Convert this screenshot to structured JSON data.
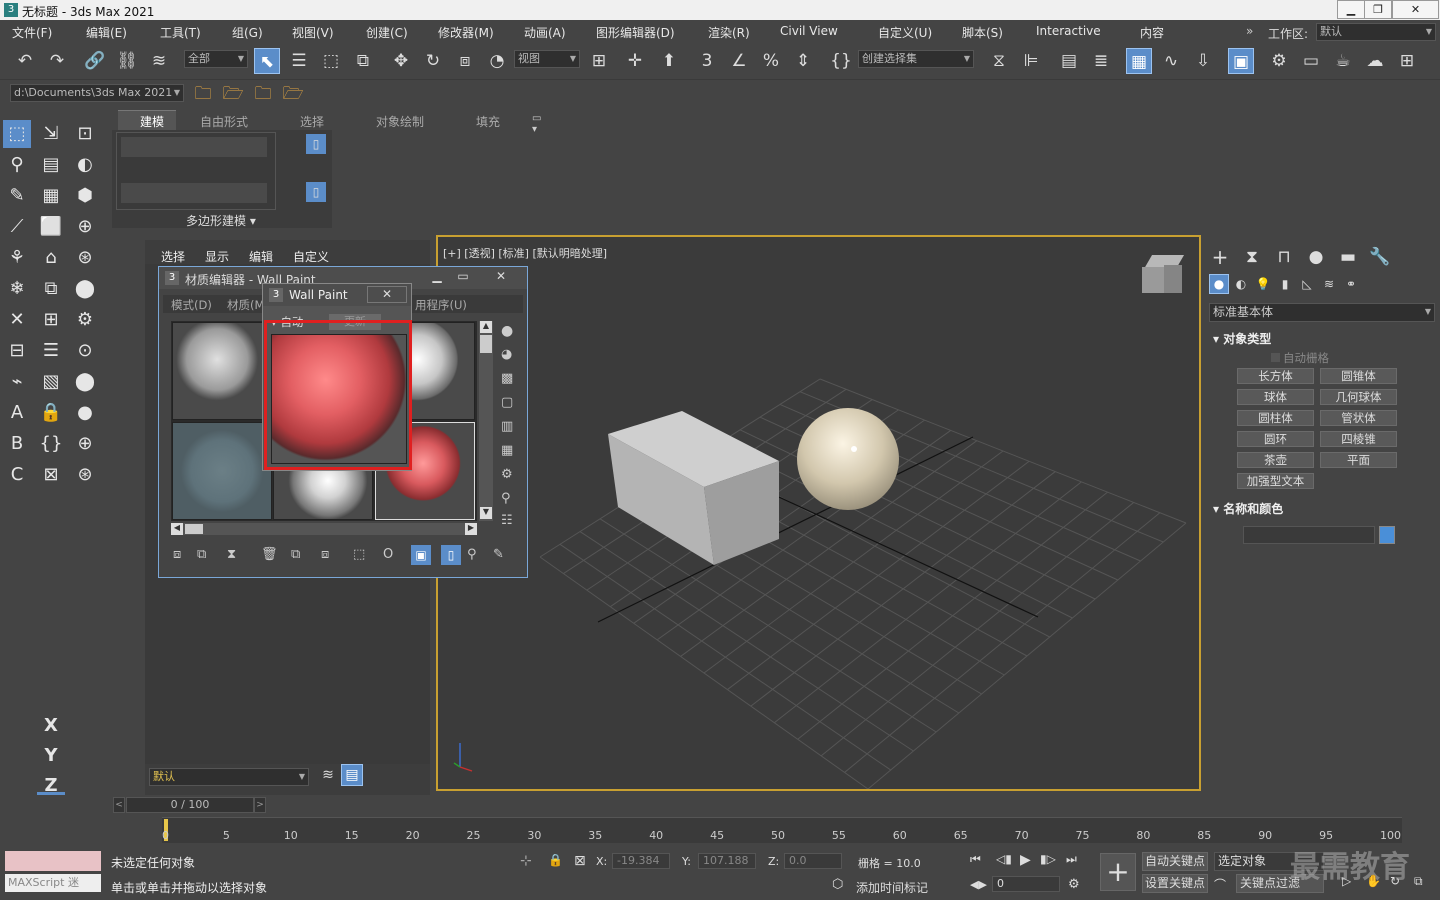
{
  "window": {
    "title": "无标题 - 3ds Max 2021"
  },
  "menu": [
    "文件(F)",
    "编辑(E)",
    "工具(T)",
    "组(G)",
    "视图(V)",
    "创建(C)",
    "修改器(M)",
    "动画(A)",
    "图形编辑器(D)",
    "渲染(R)",
    "Civil View",
    "自定义(U)",
    "脚本(S)",
    "Interactive",
    "内容"
  ],
  "workspace": {
    "label": "工作区:",
    "value": "默认"
  },
  "toolbar": {
    "filter_value": "全部",
    "refcoord_value": "视图",
    "selset_value": "创建选择集",
    "path_value": "d:\\Documents\\3ds Max 2021",
    "icons": [
      "undo-icon",
      "redo-icon",
      "link-icon",
      "unlink-icon",
      "bind-space-warp-icon",
      "select-icon",
      "select-by-name-icon",
      "rect-select-icon",
      "window-crossing-icon",
      "move-icon",
      "rotate-icon",
      "scale-icon",
      "select-manipulate-icon"
    ]
  },
  "ribbon": {
    "tabs": [
      "建模",
      "自由形式",
      "选择",
      "对象绘制",
      "填充"
    ],
    "active_tab": "建模",
    "group_label": "多边形建模"
  },
  "scene_explorer": {
    "tabs": [
      "选择",
      "显示",
      "编辑",
      "自定义"
    ],
    "layer_value": "默认",
    "frame_counter": "0 / 100"
  },
  "viewport": {
    "label": "[+] [透视] [标准] [默认明暗处理]"
  },
  "command_panel": {
    "category": "标准基本体",
    "object_type_header": "对象类型",
    "autogrid": "自动栅格",
    "buttons": [
      "长方体",
      "圆锥体",
      "球体",
      "几何球体",
      "圆柱体",
      "管状体",
      "圆环",
      "四棱锥",
      "茶壶",
      "平面",
      "加强型文本"
    ],
    "name_color_header": "名称和颜色",
    "swatch_color": "#4a8fd8"
  },
  "material_editor": {
    "title": "材质编辑器 - Wall Paint",
    "menus": [
      "模式(D)",
      "材质(M",
      "用程序(U)"
    ],
    "popup_title": "Wall Paint",
    "popup_auto": "自动",
    "popup_update": "更新"
  },
  "timeline": {
    "ticks": [
      "0",
      "5",
      "10",
      "15",
      "20",
      "25",
      "30",
      "35",
      "40",
      "45",
      "50",
      "55",
      "60",
      "65",
      "70",
      "75",
      "80",
      "85",
      "90",
      "95",
      "100"
    ]
  },
  "status": {
    "maxscript": "MAXScript 迷",
    "line1": "未选定任何对象",
    "line2": "单击或单击并拖动以选择对象",
    "x_label": "X:",
    "x_value": "-19.384",
    "y_label": "Y:",
    "y_value": "107.188",
    "z_label": "Z:",
    "z_value": "0.0",
    "grid": "栅格 = 10.0",
    "add_time_tag": "添加时间标记",
    "auto_key": "自动关键点",
    "set_key": "设置关键点",
    "selected_object": "选定对象",
    "key_filters": "关键点过滤器...",
    "frame_value": "0",
    "watermark": "最需教育"
  },
  "colors": {
    "accent": "#5b8dc9",
    "viewport_border": "#c8a031",
    "highlight_red": "#e02020"
  }
}
